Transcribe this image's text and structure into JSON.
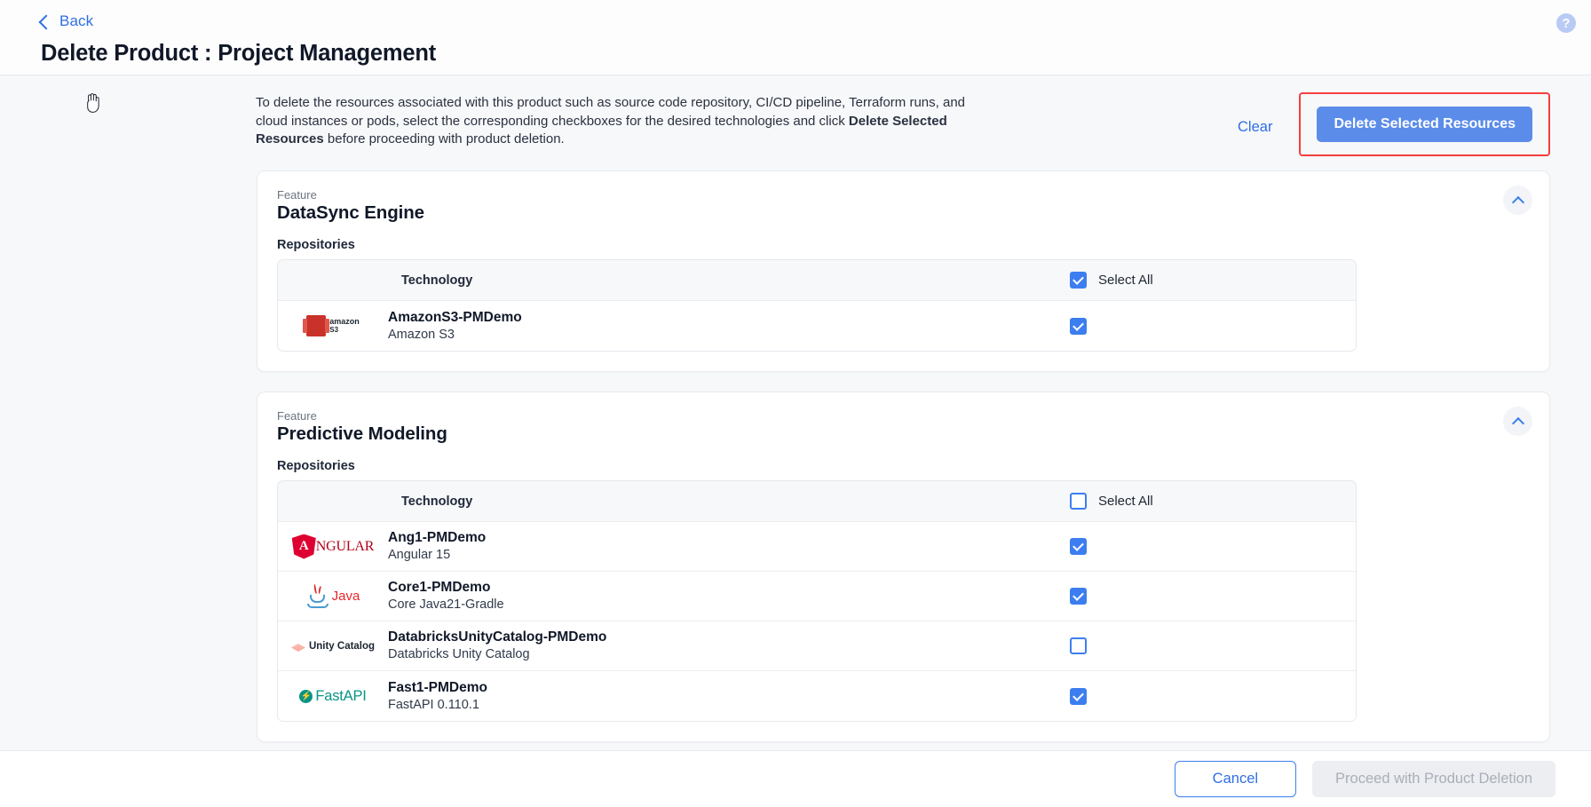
{
  "header": {
    "back_label": "Back",
    "title": "Delete Product : Project Management",
    "help_glyph": "?"
  },
  "intro": {
    "text_part1": "To delete the resources associated with this product such as source code repository, CI/CD pipeline, Terraform runs, and cloud instances or pods, select the corresponding checkboxes for the desired technologies and click ",
    "text_bold": "Delete Selected Resources",
    "text_part2": " before proceeding with product deletion.",
    "clear_label": "Clear",
    "delete_selected_label": "Delete Selected Resources",
    "highlight_color": "#f43f3f",
    "primary_button_color": "#5b8cea"
  },
  "table_headers": {
    "technology": "Technology",
    "select_all": "Select All"
  },
  "labels": {
    "feature_kicker": "Feature",
    "repositories": "Repositories"
  },
  "features": [
    {
      "kicker": "Feature",
      "name": "DataSync Engine",
      "section_label": "Repositories",
      "select_all_checked": true,
      "rows": [
        {
          "logo": "amazon-s3-logo",
          "repo": "AmazonS3-PMDemo",
          "tech": "Amazon S3",
          "checked": true
        }
      ]
    },
    {
      "kicker": "Feature",
      "name": "Predictive Modeling",
      "section_label": "Repositories",
      "select_all_checked": false,
      "rows": [
        {
          "logo": "angular-logo",
          "repo": "Ang1-PMDemo",
          "tech": "Angular 15",
          "checked": true
        },
        {
          "logo": "java-logo",
          "repo": "Core1-PMDemo",
          "tech": "Core Java21-Gradle",
          "checked": true
        },
        {
          "logo": "databricks-unity-catalog-logo",
          "repo": "DatabricksUnityCatalog-PMDemo",
          "tech": "Databricks Unity Catalog",
          "checked": false
        },
        {
          "logo": "fastapi-logo",
          "repo": "Fast1-PMDemo",
          "tech": "FastAPI 0.110.1",
          "checked": true
        }
      ]
    }
  ],
  "footer": {
    "cancel_label": "Cancel",
    "proceed_label": "Proceed with Product Deletion"
  }
}
